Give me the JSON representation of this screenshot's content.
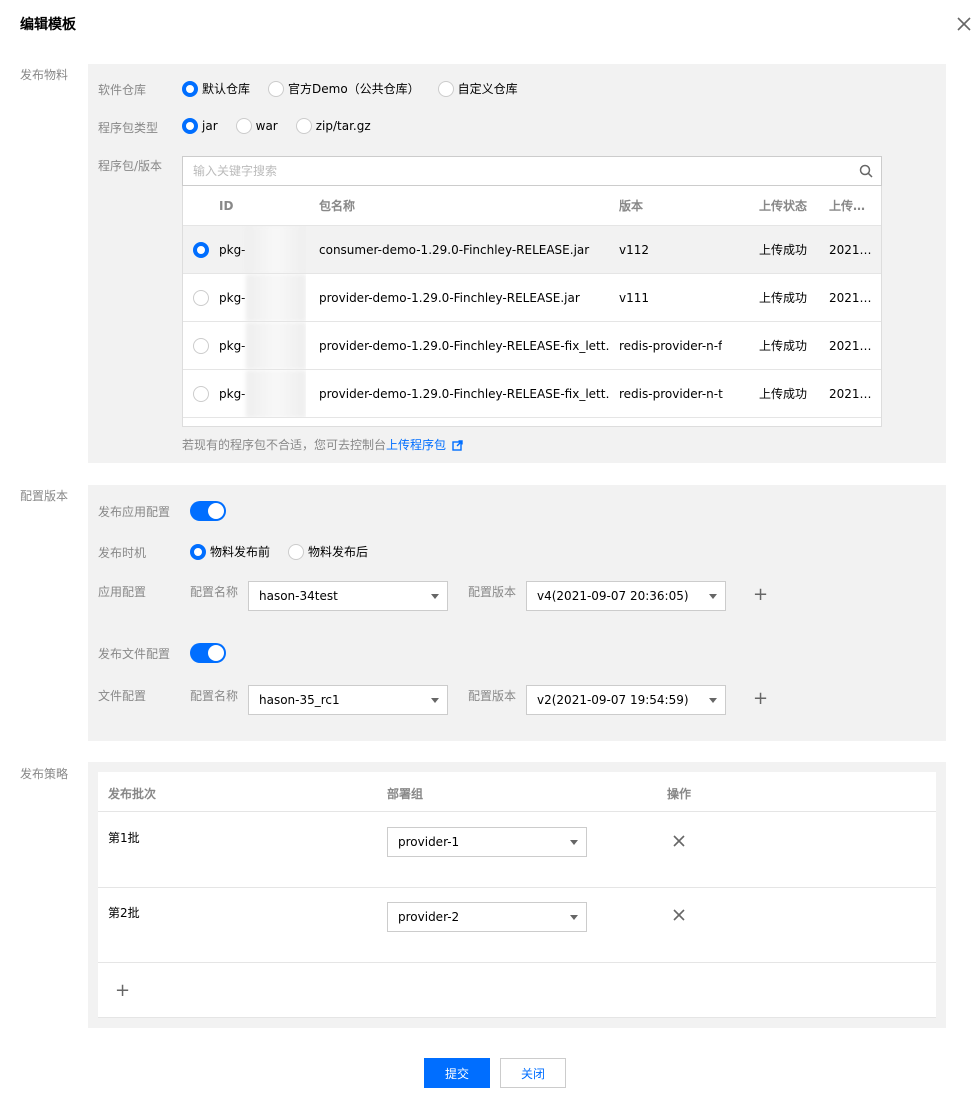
{
  "dialog": {
    "title": "编辑模板"
  },
  "publish_material": {
    "section_label": "发布物料",
    "repo": {
      "label": "软件仓库",
      "options": [
        "默认仓库",
        "官方Demo（公共仓库）",
        "自定义仓库"
      ],
      "selected": 0
    },
    "pkg_type": {
      "label": "程序包类型",
      "options": [
        "jar",
        "war",
        "zip/tar.gz"
      ],
      "selected": 0
    },
    "pkg_version": {
      "label": "程序包/版本",
      "search_placeholder": "输入关键字搜索",
      "columns": [
        "ID",
        "包名称",
        "版本",
        "上传状态",
        "上传…"
      ],
      "rows": [
        {
          "id": "pkg-",
          "name": "consumer-demo-1.29.0-Finchley-RELEASE.jar",
          "version": "v112",
          "status": "上传成功",
          "time": "2021…",
          "selected": true
        },
        {
          "id": "pkg-",
          "name": "provider-demo-1.29.0-Finchley-RELEASE.jar",
          "version": "v111",
          "status": "上传成功",
          "time": "2021…",
          "selected": false
        },
        {
          "id": "pkg-",
          "name": "provider-demo-1.29.0-Finchley-RELEASE-fix_lett…",
          "version": "redis-provider-n-f",
          "status": "上传成功",
          "time": "2021…",
          "selected": false
        },
        {
          "id": "pkg-",
          "name": "provider-demo-1.29.0-Finchley-RELEASE-fix_lett…",
          "version": "redis-provider-n-t",
          "status": "上传成功",
          "time": "2021…",
          "selected": false
        }
      ]
    },
    "hint_text": "若现有的程序包不合适，您可去控制台",
    "hint_link": "上传程序包"
  },
  "config_version": {
    "section_label": "配置版本",
    "publish_app_config": {
      "label": "发布应用配置",
      "enabled": true
    },
    "publish_timing": {
      "label": "发布时机",
      "options": [
        "物料发布前",
        "物料发布后"
      ],
      "selected": 0
    },
    "app_config": {
      "label": "应用配置",
      "name_label": "配置名称",
      "name_value": "hason-34test",
      "version_label": "配置版本",
      "version_value": "v4(2021-09-07 20:36:05)"
    },
    "publish_file_config": {
      "label": "发布文件配置",
      "enabled": true
    },
    "file_config": {
      "label": "文件配置",
      "name_label": "配置名称",
      "name_value": "hason-35_rc1",
      "version_label": "配置版本",
      "version_value": "v2(2021-09-07 19:54:59)"
    }
  },
  "strategy": {
    "section_label": "发布策略",
    "columns": [
      "发布批次",
      "部署组",
      "操作"
    ],
    "rows": [
      {
        "batch": "第1批",
        "group": "provider-1"
      },
      {
        "batch": "第2批",
        "group": "provider-2"
      }
    ]
  },
  "footer": {
    "submit": "提交",
    "close": "关闭"
  },
  "colors": {
    "primary": "#006eff",
    "panel_bg": "#f2f2f2"
  }
}
